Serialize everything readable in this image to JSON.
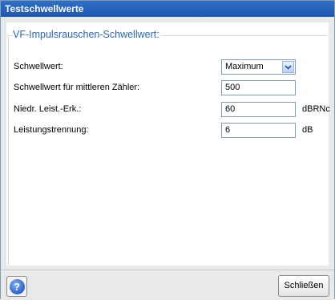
{
  "window": {
    "title": "Testschwellwerte"
  },
  "group": {
    "title": "VF-Impulsrauschen-Schwellwert:"
  },
  "rows": [
    {
      "label": "Schwellwert:",
      "value": "Maximum",
      "unit": ""
    },
    {
      "label": "Schwellwert für mittleren Zähler:",
      "value": "500",
      "unit": ""
    },
    {
      "label": "Niedr. Leist.-Erk.:",
      "value": "60",
      "unit": "dBRNc"
    },
    {
      "label": "Leistungstrennung:",
      "value": "6",
      "unit": "dB"
    }
  ],
  "footer": {
    "help_icon": "question-mark-icon",
    "close_label": "Schließen"
  },
  "colors": {
    "titlebar": "#1f57ad",
    "group_title": "#2b67b6"
  }
}
